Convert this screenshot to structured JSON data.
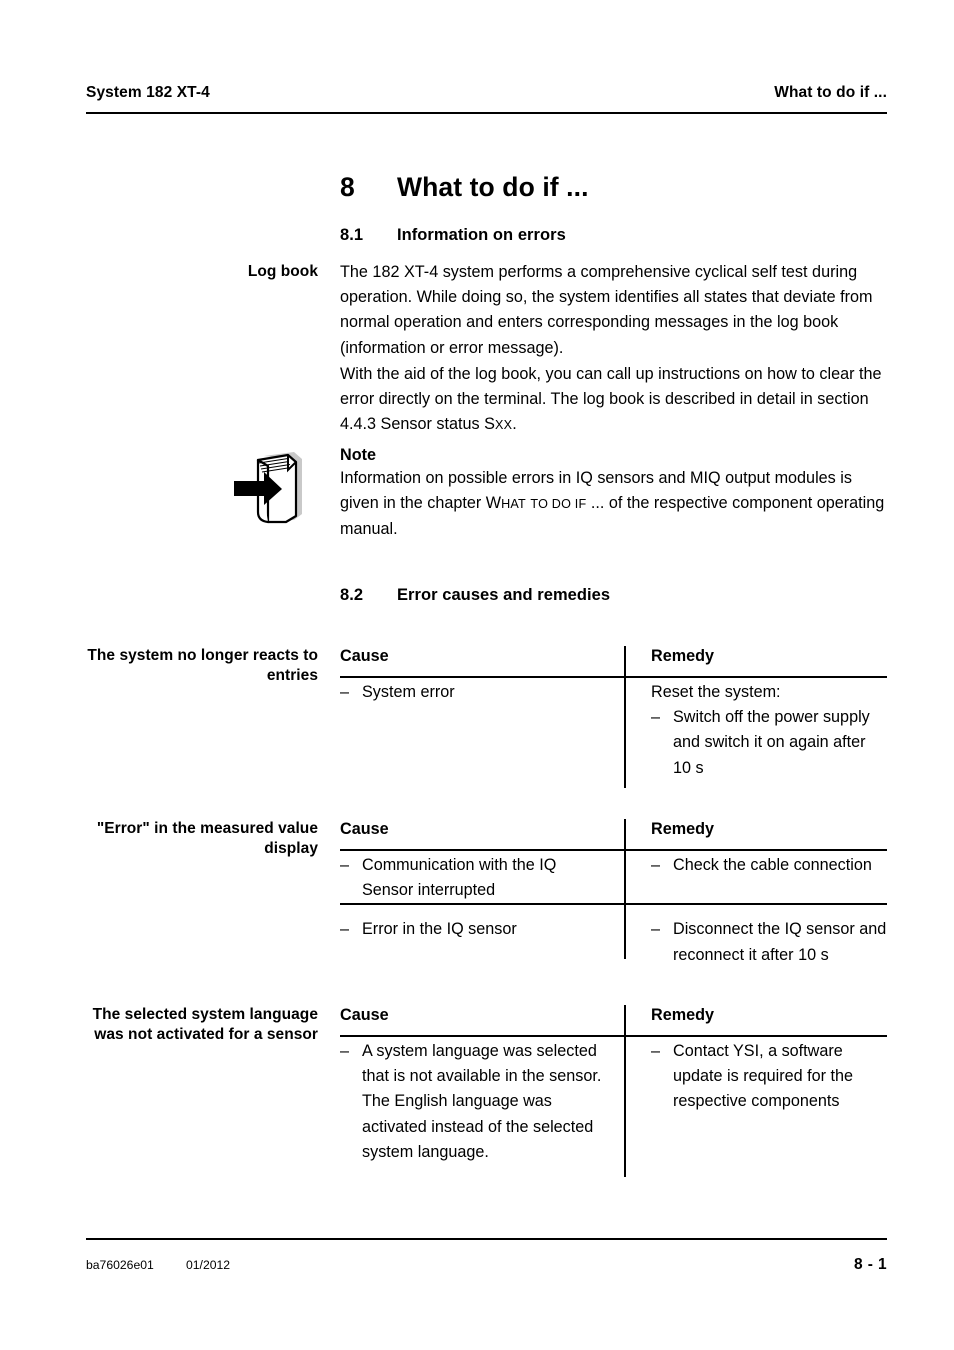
{
  "header": {
    "left": "System 182 XT-4",
    "right": "What to do if ..."
  },
  "chapter": {
    "number": "8",
    "title": "What to do if ..."
  },
  "sections": {
    "s81": {
      "number": "8.1",
      "title": "Information on errors"
    },
    "s82": {
      "number": "8.2",
      "title": "Error causes and remedies"
    }
  },
  "logbook": {
    "label": "Log book",
    "paragraph1": " The 182 XT-4 system performs a comprehensive cyclical self test during operation. While doing so, the system identifies all states that deviate from normal operation and enters corresponding messages in the log book (information or error message).",
    "paragraph2_a": "With the aid of the log book, you can call up instructions on how to clear the error directly on the terminal. The log book is described in detail in section 4.4.3 Sensor status S",
    "paragraph2_smallcaps": "XX",
    "paragraph2_b": "."
  },
  "note": {
    "icon": "note-book-arrow-icon",
    "heading": "Note",
    "text_a": "Information on possible errors in IQ sensors and MIQ output modules is given in the chapter W",
    "text_smallcaps1": "HAT",
    "text_b": " ",
    "text_smallcaps2": "TO DO IF",
    "text_c": " ... of the respective component operating manual."
  },
  "tables": [
    {
      "label": "The system no longer reacts to entries",
      "columns": [
        "Cause",
        "Remedy"
      ],
      "rows": [
        {
          "cause": [
            {
              "dash": "–",
              "text": "System error"
            }
          ],
          "remedy": [
            {
              "dash": "",
              "text": "Reset the system:"
            },
            {
              "dash": "–",
              "text": "Switch off the power supply and switch it on again after 10 s"
            }
          ]
        }
      ]
    },
    {
      "label": "\"Error\" in the measured value display",
      "columns": [
        "Cause",
        "Remedy"
      ],
      "rows": [
        {
          "cause": [
            {
              "dash": "–",
              "text": "Communication with the IQ Sensor interrupted"
            }
          ],
          "remedy": [
            {
              "dash": "–",
              "text": "Check the cable connection"
            }
          ]
        },
        {
          "cause": [
            {
              "dash": "–",
              "text": "Error in the IQ sensor"
            }
          ],
          "remedy": [
            {
              "dash": "–",
              "text": "Disconnect the IQ sensor and reconnect it after 10 s"
            }
          ]
        }
      ]
    },
    {
      "label": "The selected system language was not activated for a sensor",
      "columns": [
        "Cause",
        "Remedy"
      ],
      "rows": [
        {
          "cause": [
            {
              "dash": "–",
              "text": "A system language was selected that is not available in the sensor."
            },
            {
              "dash": "",
              "text": "The English language was activated instead of the selected system language."
            }
          ],
          "remedy": [
            {
              "dash": "–",
              "text": "Contact YSI, a software update is required for the respective components"
            }
          ]
        }
      ]
    }
  ],
  "footer": {
    "document_id": "ba76026e01",
    "date": "01/2012",
    "page": "8 - 1"
  }
}
